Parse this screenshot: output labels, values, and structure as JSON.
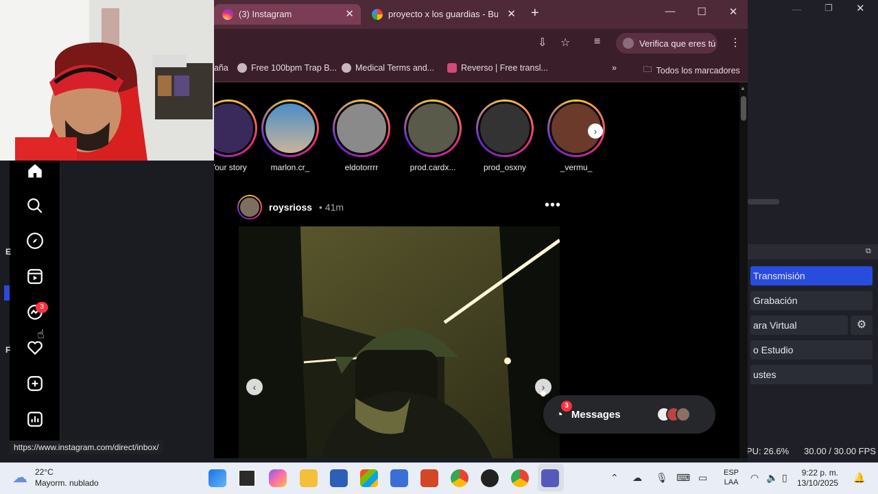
{
  "browser": {
    "tabs": [
      {
        "label": "(3) Instagram",
        "active": true
      },
      {
        "label": "proyecto x los guardias - Buscar",
        "active": false
      }
    ],
    "verify_label": "Verifica que eres tú",
    "bookmarks": [
      {
        "label": "aña"
      },
      {
        "label": "Free 100bpm Trap B..."
      },
      {
        "label": "Medical Terms and..."
      },
      {
        "label": "Reverso | Free transl..."
      }
    ],
    "all_bookmarks_label": "Todos los marcadores",
    "status_url": "https://www.instagram.com/direct/inbox/"
  },
  "instagram": {
    "stories": [
      {
        "name": "Your story"
      },
      {
        "name": "marlon.cr_"
      },
      {
        "name": "eldotorrrr"
      },
      {
        "name": "prod.cardx..."
      },
      {
        "name": "prod_osxny"
      },
      {
        "name": "_vermu_"
      }
    ],
    "post": {
      "username": "roysrioss",
      "time": "• 41m"
    },
    "notifications_count": "3",
    "messages": {
      "label": "Messages",
      "badge": "3"
    }
  },
  "obs": {
    "buttons": [
      {
        "label": "Transmisión"
      },
      {
        "label": "Grabación"
      },
      {
        "label": "ara Virtual"
      },
      {
        "label": "o Estudio"
      },
      {
        "label": "ustes"
      }
    ],
    "cpu": "PU: 26.6%",
    "fps": "30.00 / 30.00 FPS"
  },
  "taskbar": {
    "weather_temp": "22°C",
    "weather_desc": "Mayorm. nublado",
    "lang_line1": "ESP",
    "lang_line2": "LAA",
    "time": "9:22 p. m.",
    "date": "13/10/2025"
  },
  "colors": {
    "accent_blue": "#284cdb",
    "tab_active": "#7a3d55",
    "ig_badge": "#ff3040"
  }
}
